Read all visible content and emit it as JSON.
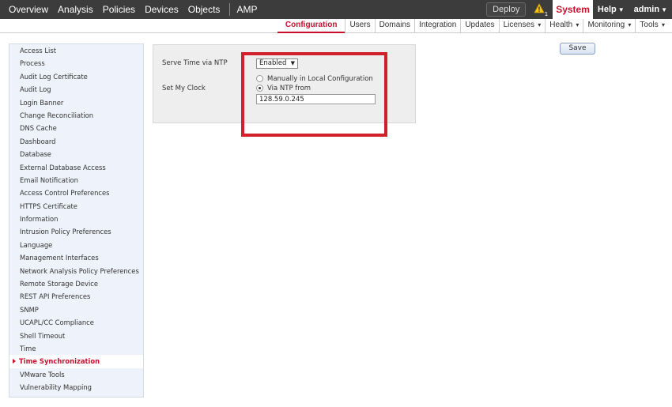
{
  "topnav": {
    "items": [
      "Overview",
      "Analysis",
      "Policies",
      "Devices",
      "Objects",
      "AMP"
    ],
    "deploy_label": "Deploy",
    "alert_count": "1",
    "system_label": "System",
    "help_label": "Help",
    "user_label": "admin"
  },
  "subnav": {
    "active_label": "Configuration",
    "items": [
      "Users",
      "Domains",
      "Integration",
      "Updates",
      "Licenses",
      "Health",
      "Monitoring",
      "Tools"
    ]
  },
  "sidebar": {
    "items": [
      "Access List",
      "Process",
      "Audit Log Certificate",
      "Audit Log",
      "Login Banner",
      "Change Reconciliation",
      "DNS Cache",
      "Dashboard",
      "Database",
      "External Database Access",
      "Email Notification",
      "Access Control Preferences",
      "HTTPS Certificate",
      "Information",
      "Intrusion Policy Preferences",
      "Language",
      "Management Interfaces",
      "Network Analysis Policy Preferences",
      "Remote Storage Device",
      "REST API Preferences",
      "SNMP",
      "UCAPL/CC Compliance",
      "Shell Timeout",
      "Time",
      "Time Synchronization",
      "VMware Tools",
      "Vulnerability Mapping"
    ],
    "active_index": 24
  },
  "form": {
    "serve_time_label": "Serve Time via NTP",
    "serve_time_value": "Enabled",
    "set_clock_label": "Set My Clock",
    "option_manual": "Manually in Local Configuration",
    "option_ntp": "Via NTP from",
    "ntp_server": "128.59.0.245"
  },
  "actions": {
    "save_label": "Save"
  },
  "colors": {
    "accent": "#c8102e",
    "highlight_box": "#d0202a",
    "topbar": "#3c3c3c"
  }
}
